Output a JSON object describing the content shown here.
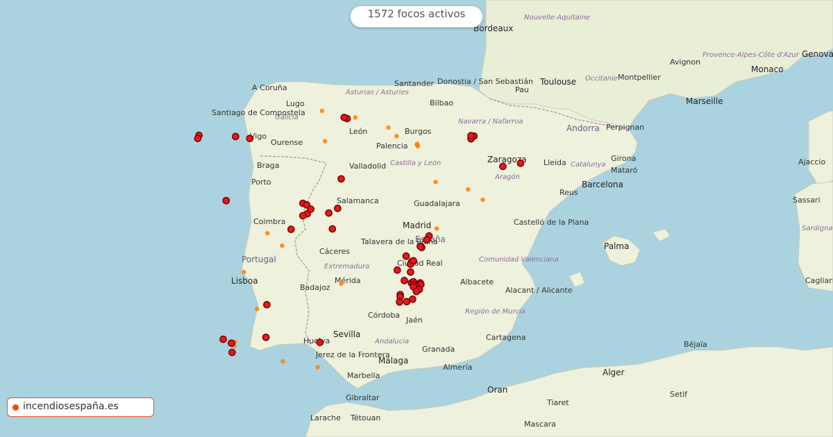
{
  "banner": {
    "active_count_text": "1572 focos activos"
  },
  "brand": {
    "site": "incendiosespaña.es"
  },
  "colors": {
    "sea": "#aad3df",
    "land": "#e8eed8",
    "active_fire": "#e31a1c",
    "recent_fire": "#ff7f00"
  },
  "map": {
    "countries": [
      {
        "name": "Portugal"
      },
      {
        "name": "España"
      },
      {
        "name": "Andorra"
      }
    ],
    "regions": [
      "Asturias / Asturies",
      "Galicia",
      "Castilla y León",
      "Navarra / Nafarroa",
      "Aragón",
      "Catalunya",
      "Extremadura",
      "Comunidad Valenciana",
      "Región de Murcia",
      "Andalucía",
      "Occitanie",
      "Nouvelle-Aquitaine",
      "Provence-Alpes-Côte d'Azur",
      "Sardigna"
    ],
    "cities": [
      "Bordeaux",
      "Toulouse",
      "Montpellier",
      "Marseille",
      "Monaco",
      "Genova",
      "Avignon",
      "Pau",
      "Perpignan",
      "Girona",
      "Mataró",
      "Barcelona",
      "Lleida",
      "Reus",
      "Zaragoza",
      "Castelló de la Plana",
      "Palma",
      "Bilbao",
      "Donostia / San Sebastián",
      "Santander",
      "A Coruña",
      "Santiago de Compostela",
      "Lugo",
      "Vigo",
      "Ourense",
      "León",
      "Burgos",
      "Palencia",
      "Valladolid",
      "Braga",
      "Porto",
      "Salamanca",
      "Guadalajara",
      "Madrid",
      "Talavera de la Reina",
      "Coimbra",
      "Cáceres",
      "Lisboa",
      "Badajoz",
      "Mérida",
      "Ciudad Real",
      "Albacete",
      "Alacant / Alicante",
      "Córdoba",
      "Jaén",
      "Sevilla",
      "Huelva",
      "Jerez de la Frontera",
      "Málaga",
      "Granada",
      "Almería",
      "Cartagena",
      "Marbella",
      "Gibraltar",
      "Larache",
      "Tétouan",
      "Ajaccio",
      "Sassari",
      "Cagliari",
      "Alger",
      "Oran",
      "Tiaret",
      "Béjaïa",
      "Setif",
      "Mascara"
    ],
    "active_fires": [
      {
        "lat": 42.72,
        "lon": -7.82
      },
      {
        "lat": 42.64,
        "lon": -7.86
      },
      {
        "lat": 42.69,
        "lon": -6.58
      },
      {
        "lat": 42.64,
        "lon": -6.1
      },
      {
        "lat": 43.15,
        "lon": -2.8
      },
      {
        "lat": 43.18,
        "lon": -2.9
      },
      {
        "lat": 42.7,
        "lon": 1.5
      },
      {
        "lat": 42.63,
        "lon": 1.4
      },
      {
        "lat": 42.71,
        "lon": 1.4
      },
      {
        "lat": 41.92,
        "lon": 2.48
      },
      {
        "lat": 42.0,
        "lon": 3.08
      },
      {
        "lat": 41.6,
        "lon": -3.0
      },
      {
        "lat": 41.04,
        "lon": -6.9
      },
      {
        "lat": 40.97,
        "lon": -4.3
      },
      {
        "lat": 40.93,
        "lon": -4.17
      },
      {
        "lat": 40.82,
        "lon": -4.03
      },
      {
        "lat": 40.7,
        "lon": -4.15
      },
      {
        "lat": 40.65,
        "lon": -4.3
      },
      {
        "lat": 40.72,
        "lon": -3.42
      },
      {
        "lat": 40.84,
        "lon": -3.12
      },
      {
        "lat": 40.3,
        "lon": -4.7
      },
      {
        "lat": 40.31,
        "lon": -3.3
      },
      {
        "lat": 40.13,
        "lon": -0.02
      },
      {
        "lat": 40.03,
        "lon": -0.1
      },
      {
        "lat": 39.83,
        "lon": -0.27
      },
      {
        "lat": 39.86,
        "lon": -0.32
      },
      {
        "lat": 39.61,
        "lon": -0.8
      },
      {
        "lat": 39.47,
        "lon": -0.61
      },
      {
        "lat": 39.4,
        "lon": -0.65
      },
      {
        "lat": 39.49,
        "lon": -0.55
      },
      {
        "lat": 39.2,
        "lon": -0.65
      },
      {
        "lat": 39.25,
        "lon": -1.1
      },
      {
        "lat": 38.98,
        "lon": -0.86
      },
      {
        "lat": 38.92,
        "lon": -0.62
      },
      {
        "lat": 38.95,
        "lon": -0.55
      },
      {
        "lat": 38.88,
        "lon": -0.55
      },
      {
        "lat": 38.88,
        "lon": -0.4
      },
      {
        "lat": 38.92,
        "lon": -0.32
      },
      {
        "lat": 38.88,
        "lon": -0.3
      },
      {
        "lat": 38.82,
        "lon": -0.45
      },
      {
        "lat": 38.82,
        "lon": -0.55
      },
      {
        "lat": 38.75,
        "lon": -0.35
      },
      {
        "lat": 38.7,
        "lon": -0.45
      },
      {
        "lat": 38.62,
        "lon": -1.0
      },
      {
        "lat": 38.56,
        "lon": -1.0
      },
      {
        "lat": 38.43,
        "lon": -1.02
      },
      {
        "lat": 38.44,
        "lon": -0.78
      },
      {
        "lat": 38.5,
        "lon": -0.58
      },
      {
        "lat": 38.36,
        "lon": -5.52
      },
      {
        "lat": 37.47,
        "lon": -7.0
      },
      {
        "lat": 37.52,
        "lon": -5.55
      },
      {
        "lat": 37.37,
        "lon": -6.72
      },
      {
        "lat": 37.13,
        "lon": -6.7
      },
      {
        "lat": 37.39,
        "lon": -3.72
      }
    ],
    "recent_fires": [
      {
        "lat": 43.35,
        "lon": -3.65
      },
      {
        "lat": 43.18,
        "lon": -2.52
      },
      {
        "lat": 42.92,
        "lon": -1.4
      },
      {
        "lat": 42.7,
        "lon": -1.12
      },
      {
        "lat": 42.5,
        "lon": -0.42
      },
      {
        "lat": 42.48,
        "lon": -0.44
      },
      {
        "lat": 42.44,
        "lon": -0.4
      },
      {
        "lat": 41.52,
        "lon": 0.2
      },
      {
        "lat": 41.33,
        "lon": 1.3
      },
      {
        "lat": 41.06,
        "lon": 1.8
      },
      {
        "lat": 40.32,
        "lon": 0.24
      },
      {
        "lat": 40.2,
        "lon": -5.5
      },
      {
        "lat": 39.88,
        "lon": -5.0
      },
      {
        "lat": 39.2,
        "lon": -6.3
      },
      {
        "lat": 38.9,
        "lon": -3.0
      },
      {
        "lat": 38.25,
        "lon": -5.85
      },
      {
        "lat": 37.4,
        "lon": -6.6
      },
      {
        "lat": 37.35,
        "lon": -6.65
      },
      {
        "lat": 37.3,
        "lon": -6.62
      },
      {
        "lat": 37.32,
        "lon": -6.7
      },
      {
        "lat": 36.9,
        "lon": -4.98
      },
      {
        "lat": 36.75,
        "lon": -3.8
      },
      {
        "lat": 42.57,
        "lon": -3.55
      }
    ]
  }
}
